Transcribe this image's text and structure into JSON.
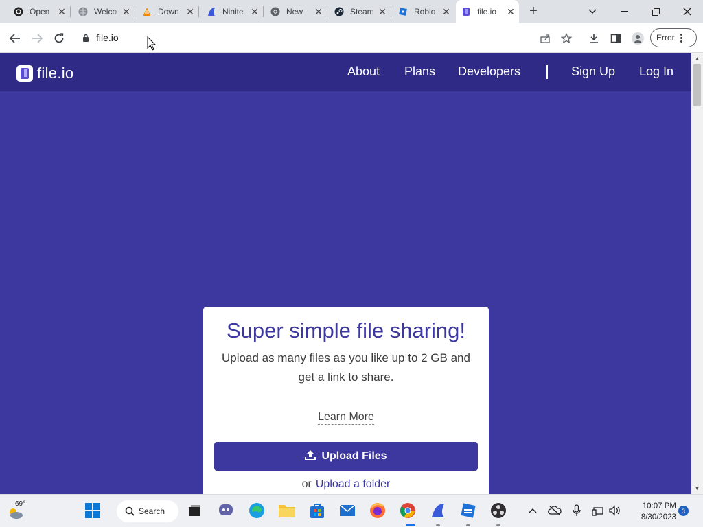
{
  "browser": {
    "tabs": [
      {
        "title": "Open",
        "icon": "openai-icon"
      },
      {
        "title": "Welco",
        "icon": "globe-icon"
      },
      {
        "title": "Down",
        "icon": "vlc-icon"
      },
      {
        "title": "Ninite",
        "icon": "ninite-icon"
      },
      {
        "title": "New",
        "icon": "chrome-icon"
      },
      {
        "title": "Steam",
        "icon": "steam-icon"
      },
      {
        "title": "Roblo",
        "icon": "roblox-icon"
      },
      {
        "title": "file.io",
        "icon": "fileio-icon"
      }
    ],
    "active_tab": 7,
    "url": "file.io",
    "profile_button": "Error"
  },
  "site": {
    "logo_text": "file.io",
    "nav": [
      "About",
      "Plans",
      "Developers",
      "Sign Up",
      "Log In"
    ],
    "card": {
      "title": "Super simple file sharing!",
      "subtitle": "Upload as many files as you like up to 2 GB and get a link to share.",
      "learn_more": "Learn More",
      "upload_button": "Upload Files",
      "or": "or",
      "upload_folder": "Upload a folder"
    }
  },
  "taskbar": {
    "weather_temp": "69°",
    "search_label": "Search",
    "time": "10:07 PM",
    "date": "8/30/2023",
    "notification_count": "3"
  },
  "colors": {
    "page_bg": "#3d38a0",
    "nav_bg": "#2f2a85",
    "accent": "#3d38a0"
  }
}
